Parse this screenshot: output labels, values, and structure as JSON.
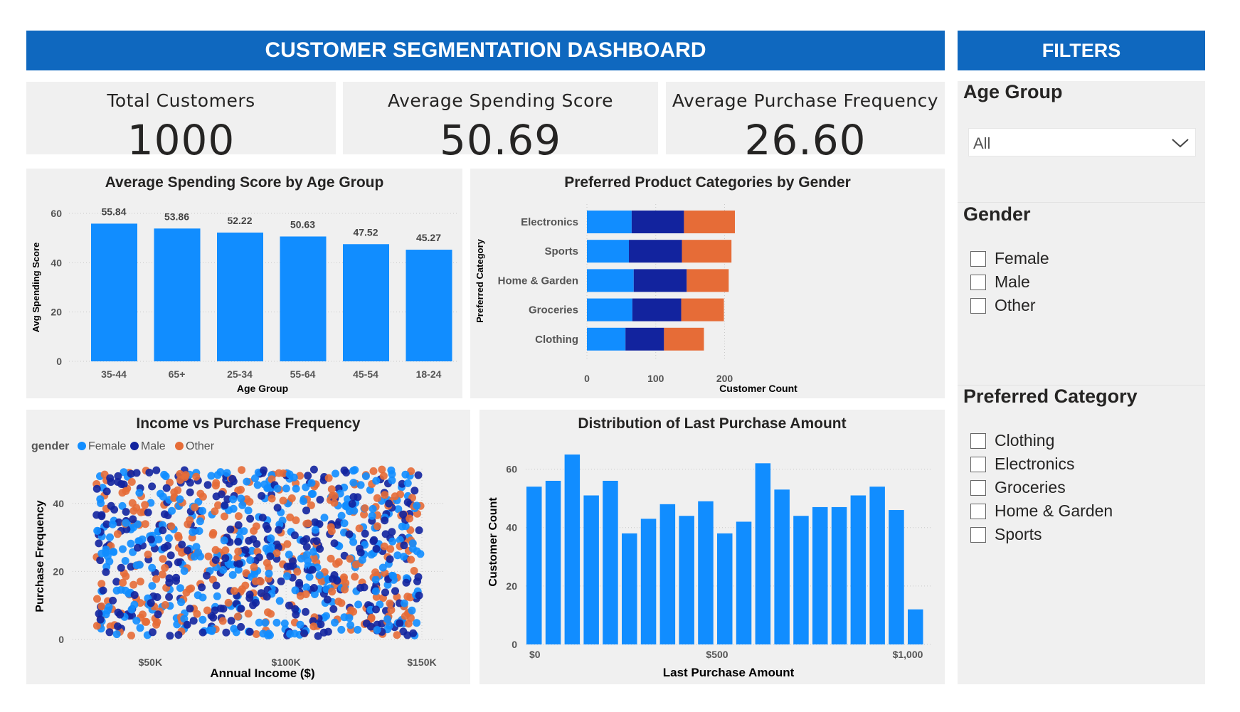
{
  "header": {
    "title": "CUSTOMER SEGMENTATION DASHBOARD"
  },
  "filters_header": {
    "title": "FILTERS"
  },
  "kpis": [
    {
      "label": "Total Customers",
      "value": "1000"
    },
    {
      "label": "Average Spending Score",
      "value": "50.69"
    },
    {
      "label": "Average Purchase Frequency",
      "value": "26.60"
    }
  ],
  "colors": {
    "accent": "#0f68bf",
    "blue": "#118dff",
    "navy": "#12239e",
    "orange": "#e66c37",
    "panel": "#f0f0f0"
  },
  "filters": {
    "age_group": {
      "title": "Age Group",
      "selected": "All"
    },
    "gender": {
      "title": "Gender",
      "options": [
        "Female",
        "Male",
        "Other"
      ]
    },
    "category": {
      "title": "Preferred Category",
      "options": [
        "Clothing",
        "Electronics",
        "Groceries",
        "Home & Garden",
        "Sports"
      ]
    }
  },
  "chart_data": [
    {
      "id": "age_bar",
      "type": "bar",
      "title": "Average Spending Score by Age Group",
      "xlabel": "Age Group",
      "ylabel": "Avg Spending Score",
      "categories": [
        "35-44",
        "65+",
        "25-34",
        "55-64",
        "45-54",
        "18-24"
      ],
      "values": [
        55.84,
        53.86,
        52.22,
        50.63,
        47.52,
        45.27
      ],
      "data_labels": [
        "55.84",
        "53.86",
        "52.22",
        "50.63",
        "47.52",
        "45.27"
      ],
      "yticks": [
        0,
        20,
        40,
        60
      ],
      "ylim": [
        0,
        60
      ],
      "grid": true
    },
    {
      "id": "category_stack",
      "type": "bar",
      "orientation": "horizontal",
      "stacked": true,
      "title": "Preferred Product Categories by Gender",
      "xlabel": "Customer Count",
      "ylabel": "Preferred Category",
      "categories": [
        "Electronics",
        "Sports",
        "Home & Garden",
        "Groceries",
        "Clothing"
      ],
      "series": [
        {
          "values": [
            65,
            61,
            68,
            66,
            56
          ]
        },
        {
          "values": [
            76,
            77,
            77,
            71,
            56
          ]
        },
        {
          "values": [
            74,
            72,
            61,
            62,
            58
          ]
        }
      ],
      "xticks": [
        0,
        100,
        200
      ],
      "xlim": [
        0,
        200
      ],
      "grid": true
    },
    {
      "id": "income_scatter",
      "type": "scatter",
      "title": "Income vs Purchase Frequency",
      "xlabel": "Annual Income ($)",
      "ylabel": "Purchase Frequency",
      "legend_title": "gender",
      "legend": [
        "Female",
        "Male",
        "Other"
      ],
      "xticks": [
        "$50K",
        "$100K",
        "$150K"
      ],
      "xtick_values": [
        50000,
        100000,
        150000
      ],
      "yticks": [
        0,
        20,
        40
      ],
      "xlim": [
        30000,
        150000
      ],
      "ylim": [
        1,
        50
      ],
      "point_count": 1000,
      "grid": true
    },
    {
      "id": "purchase_hist",
      "type": "bar",
      "title": "Distribution of Last Purchase Amount",
      "xlabel": "Last Purchase Amount",
      "ylabel": "Customer Count",
      "bin_start": 0,
      "bin_width": 50,
      "values": [
        54,
        56,
        65,
        51,
        56,
        38,
        43,
        48,
        44,
        49,
        38,
        42,
        62,
        53,
        44,
        47,
        47,
        51,
        54,
        46,
        12
      ],
      "xticks": [
        "$0",
        "$500",
        "$1,000"
      ],
      "yticks": [
        0,
        20,
        40,
        60
      ],
      "ylim": [
        0,
        65
      ],
      "grid": true
    }
  ]
}
